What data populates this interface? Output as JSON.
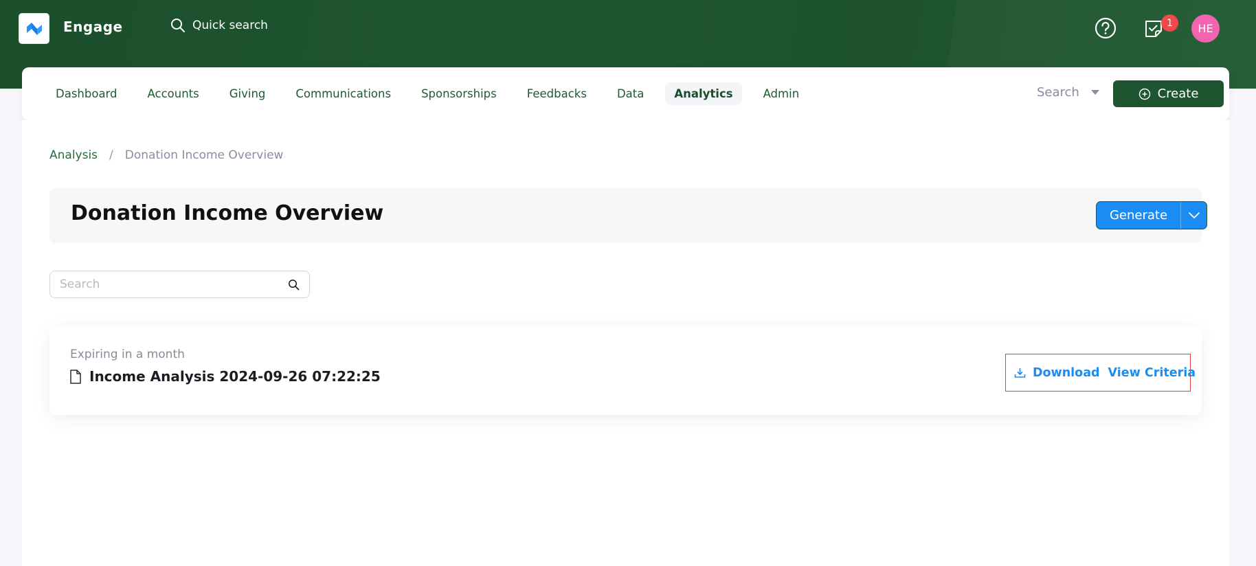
{
  "app": {
    "brand": "Engage",
    "quick_search_label": "Quick search",
    "notifications_count": "1",
    "avatar_initials": "HE",
    "colors": {
      "header_green": "#1e5530",
      "accent_blue": "#1a8cf4",
      "badge_red": "#ef4444",
      "avatar_pink": "#f25fae"
    }
  },
  "nav": {
    "items": [
      {
        "label": "Dashboard",
        "active": false
      },
      {
        "label": "Accounts",
        "active": false
      },
      {
        "label": "Giving",
        "active": false
      },
      {
        "label": "Communications",
        "active": false
      },
      {
        "label": "Sponsorships",
        "active": false
      },
      {
        "label": "Feedbacks",
        "active": false
      },
      {
        "label": "Data",
        "active": false
      },
      {
        "label": "Analytics",
        "active": true
      },
      {
        "label": "Admin",
        "active": false
      }
    ],
    "search_label": "Search",
    "create_label": "Create"
  },
  "breadcrumb": {
    "parent": "Analysis",
    "separator": "/",
    "current": "Donation Income Overview"
  },
  "page": {
    "title": "Donation Income Overview",
    "generate_label": "Generate"
  },
  "search": {
    "placeholder": "Search",
    "value": ""
  },
  "reports": [
    {
      "expiry": "Expiring in a month",
      "name": "Income Analysis 2024-09-26 07:22:25",
      "download_label": "Download",
      "view_criteria_label": "View Criteria"
    }
  ]
}
